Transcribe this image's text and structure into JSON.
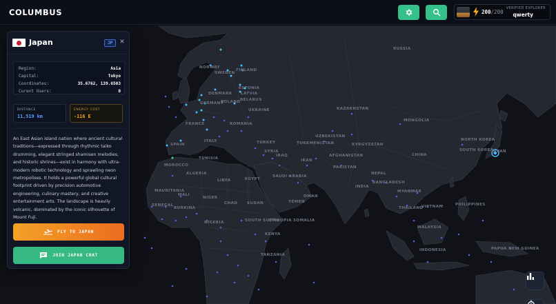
{
  "app": {
    "title": "COLUMBUS"
  },
  "header": {
    "settings_icon": "gear-icon",
    "search_icon": "search-icon",
    "energy_current": "200",
    "energy_max": "/200",
    "user_badge": "VERIFIED EXPLORER",
    "username": "qwerty"
  },
  "panel": {
    "country": "Japan",
    "country_code": "JP",
    "close_label": "✕",
    "info": [
      {
        "key": "Region:",
        "value": "Asia"
      },
      {
        "key": "Capital:",
        "value": "Tokyo"
      },
      {
        "key": "Coordinates:",
        "value": "35.6762, 139.6503"
      },
      {
        "key": "Curent Users:",
        "value": "0"
      }
    ],
    "distance_label": "DISTANCE",
    "distance_value": "11,519 km",
    "energy_cost_label": "ENERGY COST",
    "energy_cost_value": "-116 E",
    "description": "An East Asian island nation where ancient cultural traditions—expressed through rhythmic taiko drumming, elegant stringed shamisen melodies, and historic shrines—exist in harmony with ultra-modern robotic technology and sprawling neon metropolises. It holds a powerful global cultural footprint driven by precision automotive engineering, culinary mastery, and creative entertainment arts. The landscape is heavily volcanic, dominated by the iconic silhouette of Mount Fuji.",
    "fly_button": "FLY TO JAPAN",
    "chat_button": "JOIN JAPAN CHAT"
  },
  "map": {
    "labels": [
      "RUSSIA",
      "NORWAY",
      "SWEDEN",
      "FINLAND",
      "ESTONIA",
      "LATVIA",
      "DENMARK",
      "POLAND",
      "BELARUS",
      "UKRAINE",
      "GERMANY",
      "ROMANIA",
      "ITALY",
      "SPAIN",
      "FRANCE",
      "TURKEY",
      "KAZAKHSTAN",
      "MONGOLIA",
      "CHINA",
      "UZBEKISTAN",
      "TURKMENISTAN",
      "AFGHANISTAN",
      "PAKISTAN",
      "IRAN",
      "IRAQ",
      "SYRIA",
      "SAUDI ARABIA",
      "INDIA",
      "NEPAL",
      "BANGLADESH",
      "MYANMAR",
      "THAILAND",
      "VIETNAM",
      "PHILIPPINES",
      "MALAYSIA",
      "INDONESIA",
      "PAPUA NEW GUINEA",
      "MOROCCO",
      "ALGERIA",
      "LIBYA",
      "EGYPT",
      "TUNISIA",
      "MAURITANIA",
      "MALI",
      "NIGER",
      "CHAD",
      "SUDAN",
      "SOUTH SUDAN",
      "ETHIOPIA",
      "SOMALIA",
      "KENYA",
      "TANZANIA",
      "NIGERIA",
      "SENEGAL",
      "BURKINA",
      "OMAN",
      "YEMEN",
      "JAPAN",
      "SOUTH KOREA",
      "NORTH KOREA",
      "KYRGYZSTAN"
    ],
    "selected_marker": "Japan"
  },
  "controls": {
    "stats_icon": "bar-chart-icon",
    "locate_icon": "crosshair-icon"
  },
  "colors": {
    "accent_green": "#36c08a",
    "fly_orange_start": "#f3a227",
    "fly_orange_end": "#ec6c1f",
    "highlight_blue": "#5aa0ff",
    "energy_orange": "#f5a623"
  }
}
